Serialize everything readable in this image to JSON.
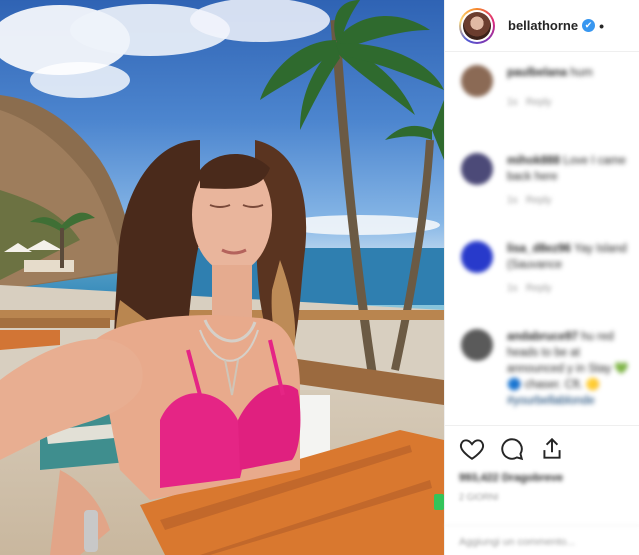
{
  "post": {
    "username": "bellathorne",
    "verified_icon": "✔",
    "more_dot": "•",
    "photo_description_icon": "beach-photo"
  },
  "comments": [
    {
      "author": "paulbelana",
      "text": "hum",
      "time": "1s",
      "reply": "Reply",
      "avatar_color": "#8b6a55"
    },
    {
      "author": "mihok888",
      "text": "Love I came back here",
      "time": "1s",
      "reply": "Reply",
      "avatar_color": "#4c4a78"
    },
    {
      "author": "lisa_d8ez96",
      "text": "Yay Island (Sauvance",
      "time": "1s",
      "reply": "Reply",
      "avatar_color": "#283acb"
    },
    {
      "author": "andabruce97",
      "text": "hu red heads to be at announced y in Stay 💚 🔵 chaser. Cft. 🟡",
      "link": "#yourbellablonde",
      "time": "",
      "reply": "",
      "avatar_color": "#5a5a5a"
    }
  ],
  "footer": {
    "likes": "993,422 Dragobreve",
    "time": "2 giorni",
    "add_comment_placeholder": "Aggiungi un commento..."
  },
  "colors": {
    "verified": "#3897f0",
    "bikini": "#e52585",
    "table": "#d9782f"
  }
}
